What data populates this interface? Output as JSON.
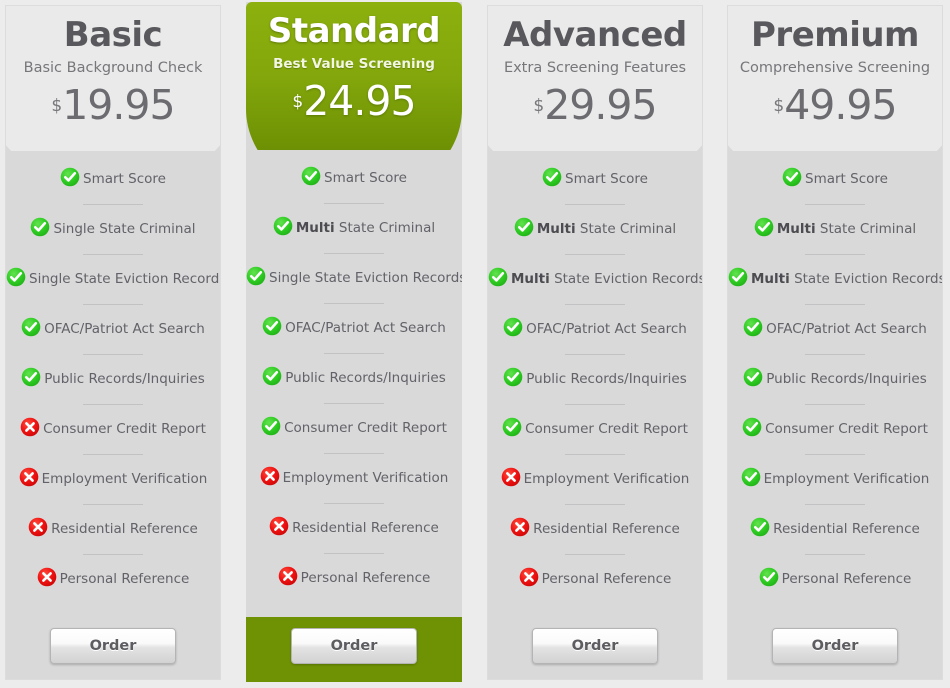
{
  "icons": {
    "check": "check-circle-icon",
    "cross": "cross-circle-icon"
  },
  "colors": {
    "accent_green": "#6f9204",
    "header_green_light": "#8cb00d",
    "check_green": "#2ecc22",
    "cross_red": "#ee1111",
    "column_bg": "#d9d9da",
    "page_bg": "#ececec",
    "text_gray": "#636268"
  },
  "currency_symbol": "$",
  "order_label": "Order",
  "plans": [
    {
      "name": "Basic",
      "tagline": "Basic Background Check",
      "price": "19.95",
      "highlighted": false,
      "features": [
        {
          "label": "Smart Score",
          "bold_prefix": "",
          "included": true
        },
        {
          "label": "Single State Criminal",
          "bold_prefix": "",
          "included": true
        },
        {
          "label": "Single State Eviction Records",
          "bold_prefix": "",
          "included": true
        },
        {
          "label": "OFAC/Patriot Act Search",
          "bold_prefix": "",
          "included": true
        },
        {
          "label": "Public Records/Inquiries",
          "bold_prefix": "",
          "included": true
        },
        {
          "label": "Consumer Credit Report",
          "bold_prefix": "",
          "included": false
        },
        {
          "label": "Employment Verification",
          "bold_prefix": "",
          "included": false
        },
        {
          "label": "Residential Reference",
          "bold_prefix": "",
          "included": false
        },
        {
          "label": "Personal Reference",
          "bold_prefix": "",
          "included": false
        }
      ],
      "order_label": "Order"
    },
    {
      "name": "Standard",
      "tagline": "Best Value Screening",
      "price": "24.95",
      "highlighted": true,
      "features": [
        {
          "label": "Smart Score",
          "bold_prefix": "",
          "included": true
        },
        {
          "label": "State Criminal",
          "bold_prefix": "Multi",
          "included": true
        },
        {
          "label": "Single State Eviction Records",
          "bold_prefix": "",
          "included": true
        },
        {
          "label": "OFAC/Patriot Act Search",
          "bold_prefix": "",
          "included": true
        },
        {
          "label": "Public Records/Inquiries",
          "bold_prefix": "",
          "included": true
        },
        {
          "label": "Consumer Credit Report",
          "bold_prefix": "",
          "included": true
        },
        {
          "label": "Employment Verification",
          "bold_prefix": "",
          "included": false
        },
        {
          "label": "Residential Reference",
          "bold_prefix": "",
          "included": false
        },
        {
          "label": "Personal Reference",
          "bold_prefix": "",
          "included": false
        }
      ],
      "order_label": "Order"
    },
    {
      "name": "Advanced",
      "tagline": "Extra Screening Features",
      "price": "29.95",
      "highlighted": false,
      "features": [
        {
          "label": "Smart Score",
          "bold_prefix": "",
          "included": true
        },
        {
          "label": "State Criminal",
          "bold_prefix": "Multi",
          "included": true
        },
        {
          "label": "State Eviction Records",
          "bold_prefix": "Multi",
          "included": true
        },
        {
          "label": "OFAC/Patriot Act Search",
          "bold_prefix": "",
          "included": true
        },
        {
          "label": "Public Records/Inquiries",
          "bold_prefix": "",
          "included": true
        },
        {
          "label": "Consumer Credit Report",
          "bold_prefix": "",
          "included": true
        },
        {
          "label": "Employment Verification",
          "bold_prefix": "",
          "included": false
        },
        {
          "label": "Residential Reference",
          "bold_prefix": "",
          "included": false
        },
        {
          "label": "Personal Reference",
          "bold_prefix": "",
          "included": false
        }
      ],
      "order_label": "Order"
    },
    {
      "name": "Premium",
      "tagline": "Comprehensive Screening",
      "price": "49.95",
      "highlighted": false,
      "features": [
        {
          "label": "Smart Score",
          "bold_prefix": "",
          "included": true
        },
        {
          "label": "State Criminal",
          "bold_prefix": "Multi",
          "included": true
        },
        {
          "label": "State Eviction Records",
          "bold_prefix": "Multi",
          "included": true
        },
        {
          "label": "OFAC/Patriot Act Search",
          "bold_prefix": "",
          "included": true
        },
        {
          "label": "Public Records/Inquiries",
          "bold_prefix": "",
          "included": true
        },
        {
          "label": "Consumer Credit Report",
          "bold_prefix": "",
          "included": true
        },
        {
          "label": "Employment Verification",
          "bold_prefix": "",
          "included": true
        },
        {
          "label": "Residential Reference",
          "bold_prefix": "",
          "included": true
        },
        {
          "label": "Personal Reference",
          "bold_prefix": "",
          "included": true
        }
      ],
      "order_label": "Order"
    }
  ]
}
